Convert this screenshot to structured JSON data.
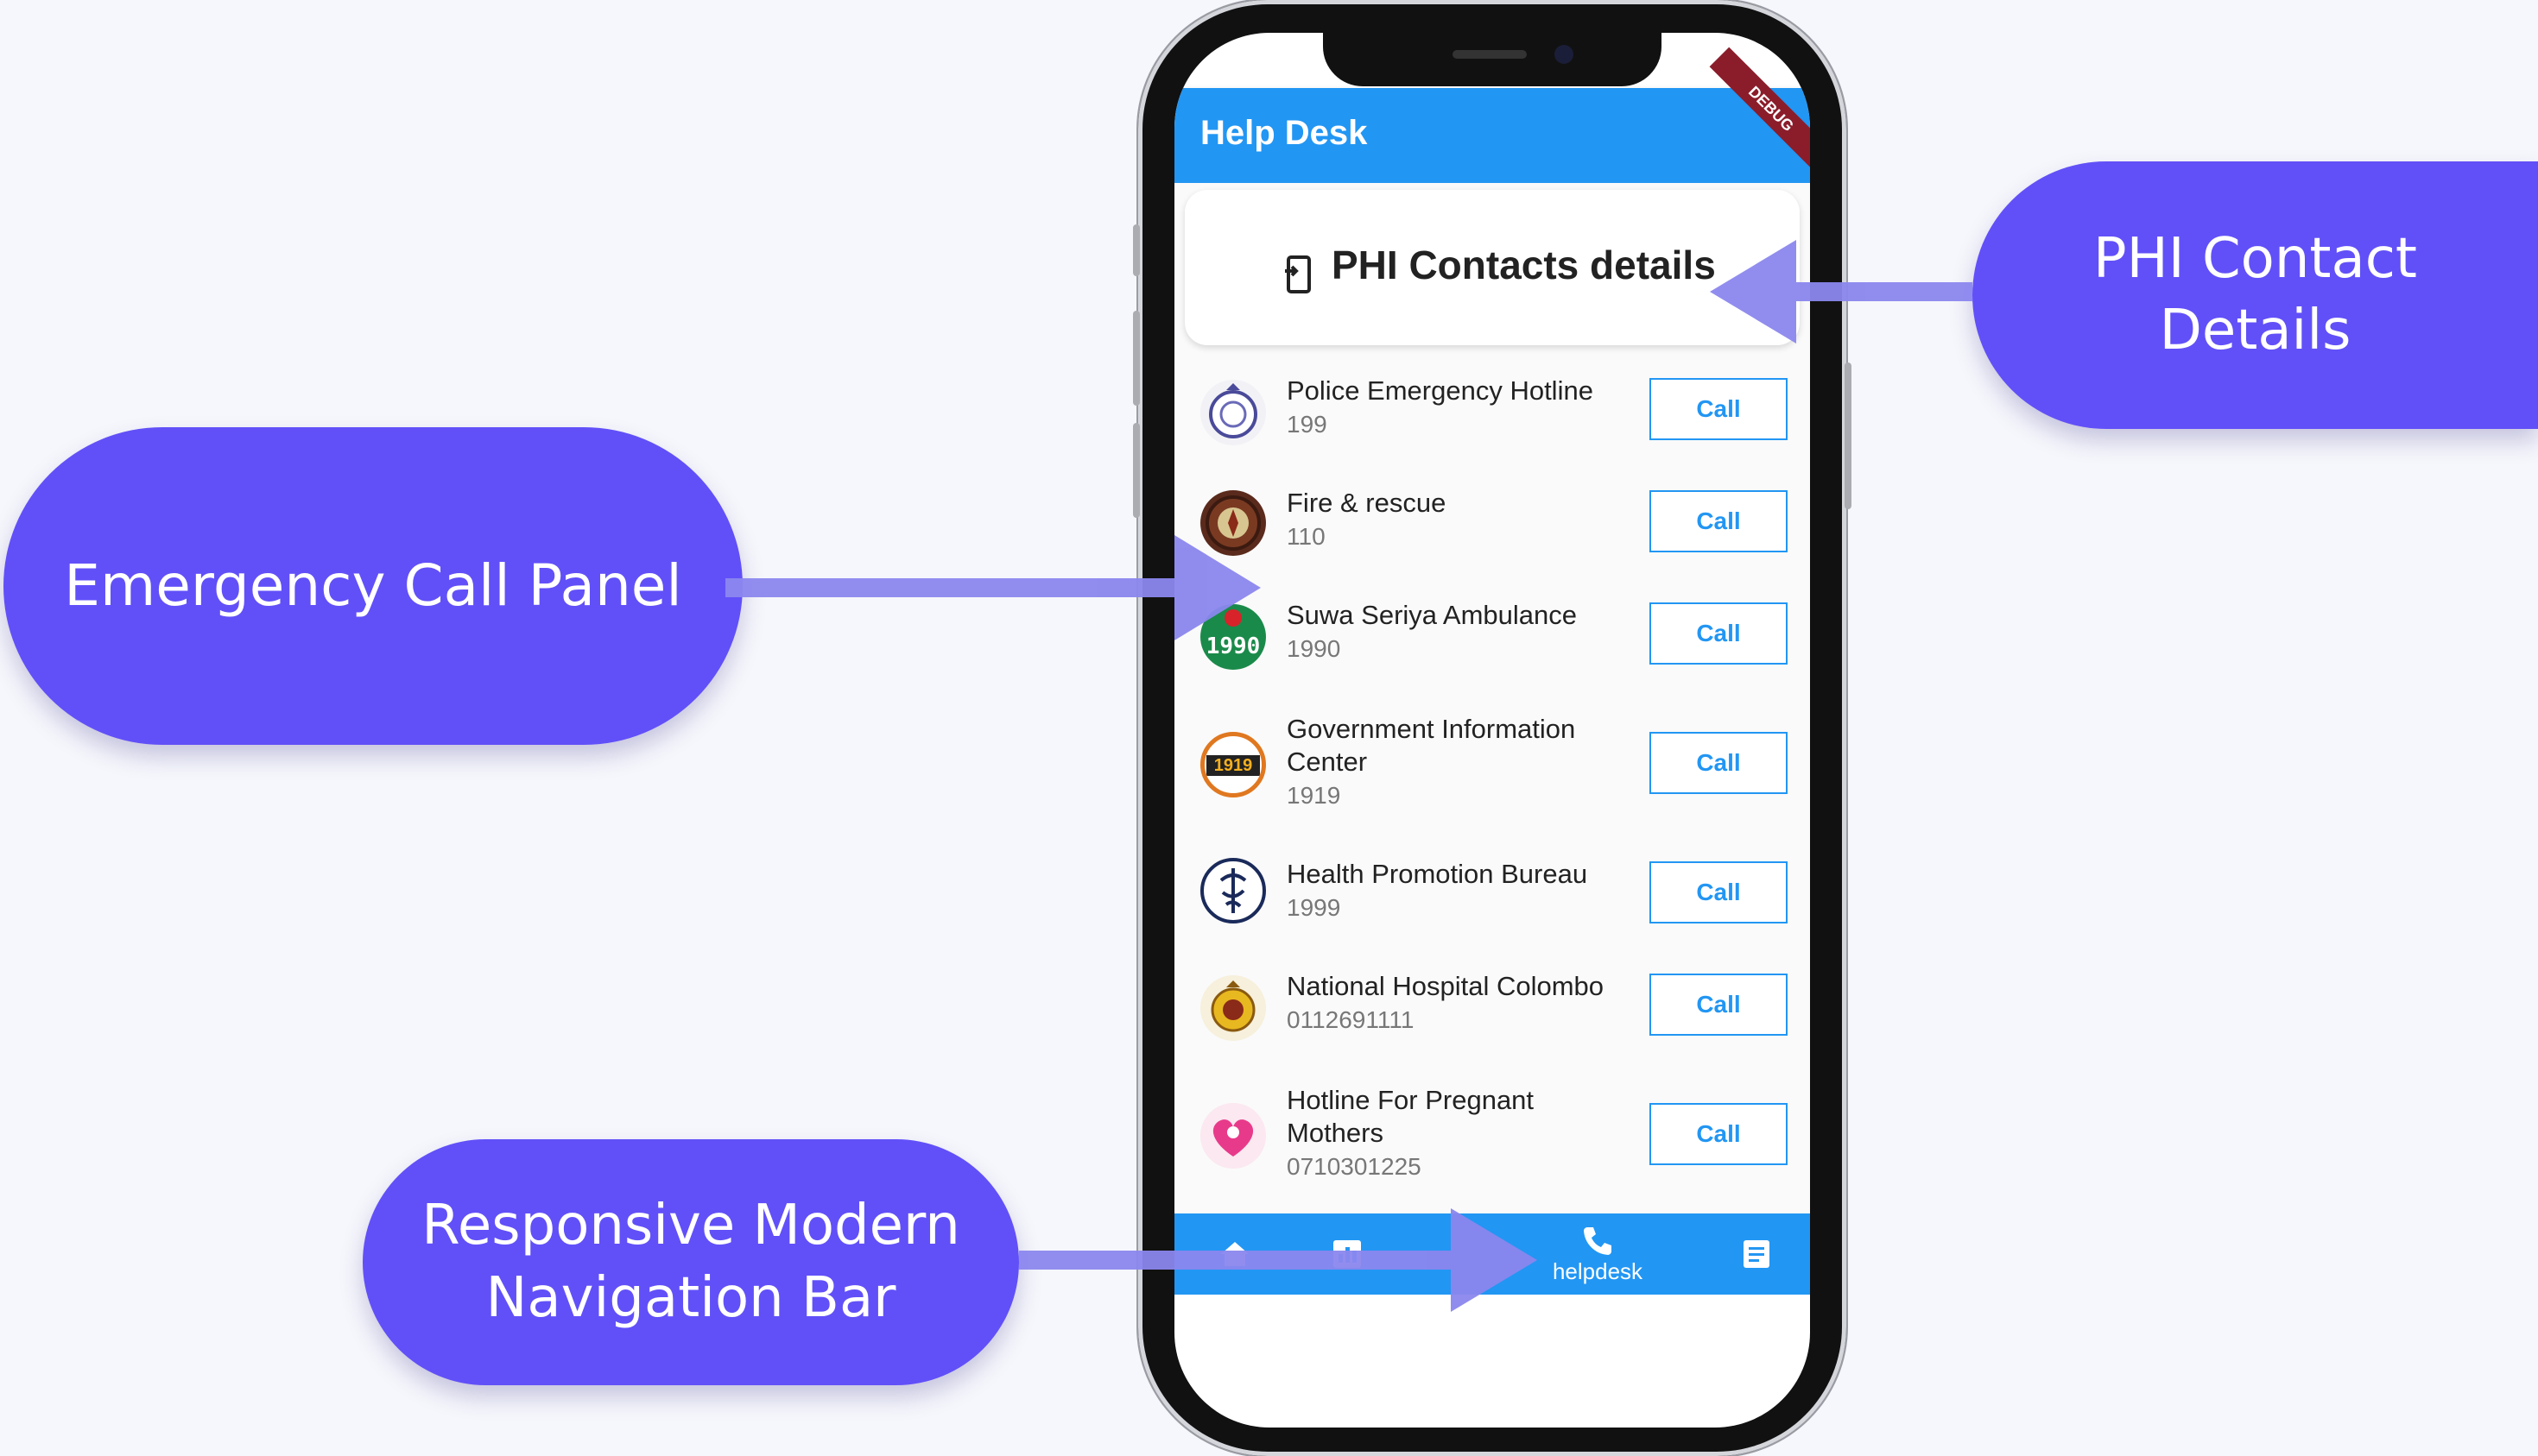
{
  "callouts": {
    "emergency": "Emergency Call Panel",
    "phi_line1": "PHI Contact",
    "phi_line2": "Details",
    "nav_line1": "Responsive Modern",
    "nav_line2": "Navigation Bar"
  },
  "app": {
    "title": "Help Desk",
    "debug_banner": "DEBUG",
    "card_title": "PHI Contacts details",
    "call_label": "Call",
    "contacts": [
      {
        "name": "Police Emergency Hotline",
        "number": "199",
        "logo": "police-logo-icon"
      },
      {
        "name": "Fire & rescue",
        "number": "110",
        "logo": "fire-rescue-logo-icon"
      },
      {
        "name": "Suwa Seriya  Ambulance",
        "number": "1990",
        "logo": "ambulance-logo-icon"
      },
      {
        "name": "Government Information Center",
        "number": "1919",
        "logo": "gic-logo-icon"
      },
      {
        "name": "Health Promotion Bureau",
        "number": "1999",
        "logo": "hpb-logo-icon"
      },
      {
        "name": "National Hospital Colombo",
        "number": "0112691111",
        "logo": "national-hospital-logo-icon"
      },
      {
        "name": "Hotline For Pregnant Mothers",
        "number": "0710301225",
        "logo": "mothers-hotline-logo-icon"
      }
    ],
    "logo_text": {
      "ambulance": "1990",
      "gic": "1919"
    },
    "nav": {
      "items": [
        "home-icon",
        "dashboard-icon",
        "phone-icon",
        "document-icon"
      ],
      "active_label": "helpdesk"
    }
  },
  "colors": {
    "callout": "#6150f8",
    "arrow": "#8b87ee",
    "app_blue": "#2296f3"
  }
}
